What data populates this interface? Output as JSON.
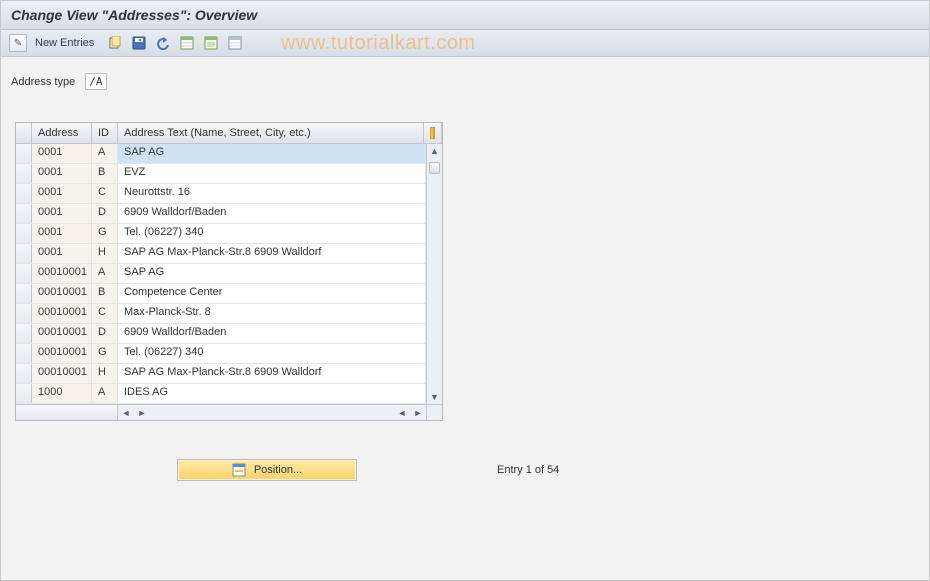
{
  "title": "Change View \"Addresses\": Overview",
  "watermark": "www.tutorialkart.com",
  "toolbar": {
    "new_entries_label": "New Entries"
  },
  "field": {
    "label": "Address type",
    "value": "/A"
  },
  "table": {
    "columns": {
      "address": "Address",
      "id": "ID",
      "text": "Address Text (Name, Street, City, etc.)"
    },
    "rows": [
      {
        "address": "0001",
        "id": "A",
        "text": "SAP AG",
        "selected": true
      },
      {
        "address": "0001",
        "id": "B",
        "text": "EVZ"
      },
      {
        "address": "0001",
        "id": "C",
        "text": "Neurottstr. 16"
      },
      {
        "address": "0001",
        "id": "D",
        "text": "6909   Walldorf/Baden"
      },
      {
        "address": "0001",
        "id": "G",
        "text": "Tel. (06227) 340"
      },
      {
        "address": "0001",
        "id": "H",
        "text": "SAP AG Max-Planck-Str.8 6909 Walldorf"
      },
      {
        "address": "00010001",
        "id": "A",
        "text": "SAP AG"
      },
      {
        "address": "00010001",
        "id": "B",
        "text": "Competence Center"
      },
      {
        "address": "00010001",
        "id": "C",
        "text": "Max-Planck-Str. 8"
      },
      {
        "address": "00010001",
        "id": "D",
        "text": "6909   Walldorf/Baden"
      },
      {
        "address": "00010001",
        "id": "G",
        "text": "Tel. (06227) 340"
      },
      {
        "address": "00010001",
        "id": "H",
        "text": "SAP AG Max-Planck-Str.8 6909 Walldorf"
      },
      {
        "address": "1000",
        "id": "A",
        "text": "IDES AG"
      }
    ]
  },
  "footer": {
    "position_label": "Position...",
    "entry_text": "Entry 1 of 54"
  }
}
